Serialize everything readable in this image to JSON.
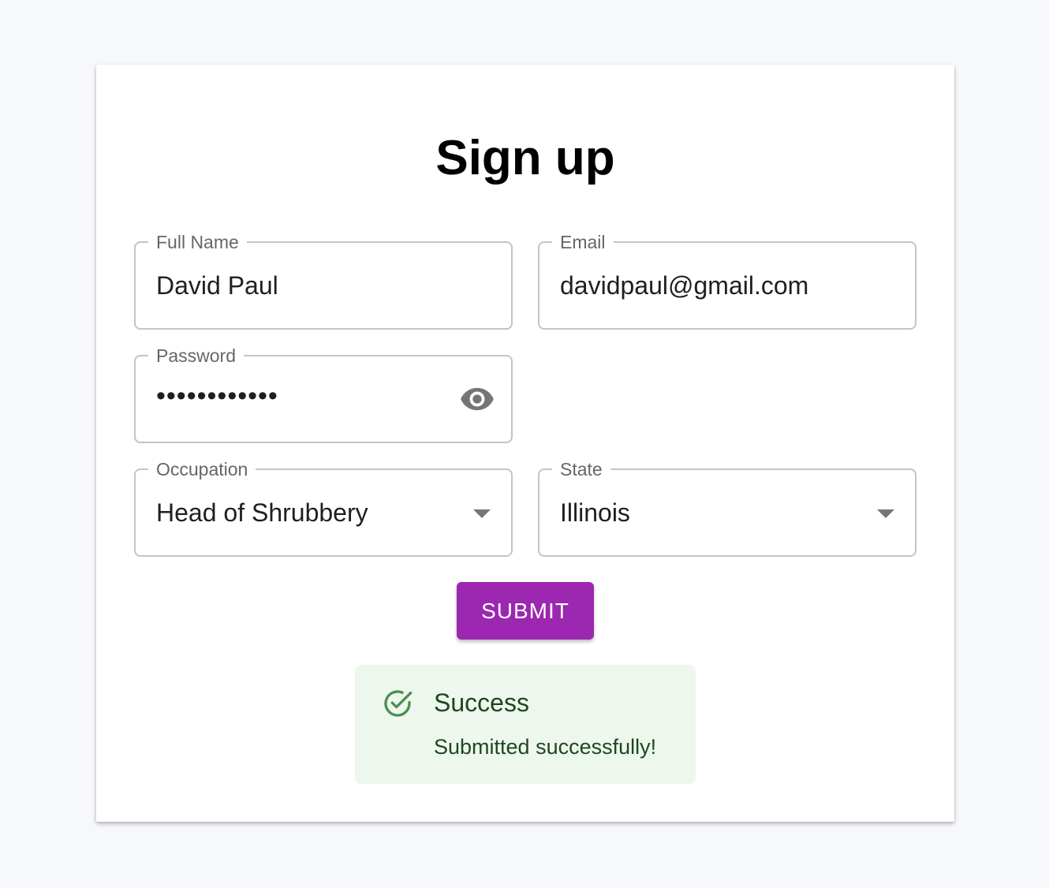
{
  "form": {
    "title": "Sign up",
    "full_name": {
      "label": "Full Name",
      "value": "David Paul"
    },
    "email": {
      "label": "Email",
      "value": "davidpaul@gmail.com"
    },
    "password": {
      "label": "Password",
      "value": "••••••••••••"
    },
    "occupation": {
      "label": "Occupation",
      "value": "Head of Shrubbery"
    },
    "state": {
      "label": "State",
      "value": "Illinois"
    },
    "submit_label": "SUBMIT"
  },
  "alert": {
    "title": "Success",
    "message": "Submitted successfully!"
  },
  "colors": {
    "accent": "#9c27b0",
    "success_bg": "#edf7ed",
    "success_text": "#1e4620",
    "success_icon": "#4c8f4f"
  },
  "icons": {
    "password_toggle": "eye-icon",
    "select_caret": "caret-down-icon",
    "alert_icon": "check-circle-icon"
  }
}
